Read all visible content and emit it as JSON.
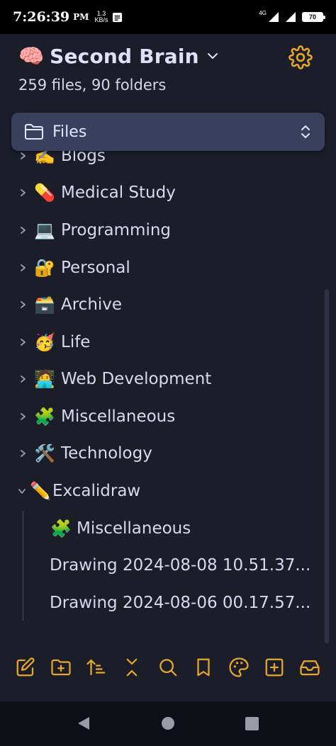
{
  "status_bar": {
    "time": "7:26:39",
    "ampm": "PM",
    "speed_value": "1.3",
    "speed_unit": "KB/s",
    "network": "4G",
    "battery": "70"
  },
  "header": {
    "vault_emoji": "🧠",
    "vault_name": "Second Brain",
    "stats": "259 files, 90 folders"
  },
  "selector": {
    "label": "Files",
    "icon": "folder-icon"
  },
  "tree": {
    "items": [
      {
        "emoji": "✍️",
        "label": "Blogs",
        "state": "collapsed"
      },
      {
        "emoji": "💊",
        "label": "Medical Study",
        "state": "collapsed"
      },
      {
        "emoji": "💻",
        "label": "Programming",
        "state": "collapsed"
      },
      {
        "emoji": "🔐",
        "label": "Personal",
        "state": "collapsed"
      },
      {
        "emoji": "🗃️",
        "label": "Archive",
        "state": "collapsed"
      },
      {
        "emoji": "🥳",
        "label": "Life",
        "state": "collapsed"
      },
      {
        "emoji": "🧑‍💻",
        "label": "Web Development",
        "state": "collapsed"
      },
      {
        "emoji": "🧩",
        "label": "Miscellaneous",
        "state": "collapsed"
      },
      {
        "emoji": "🛠️",
        "label": "Technology",
        "state": "collapsed"
      },
      {
        "emoji": "✏️",
        "label": "Excalidraw",
        "state": "expanded"
      }
    ],
    "children": [
      {
        "emoji": "🧩",
        "label": "Miscellaneous"
      },
      {
        "emoji": "",
        "label": "Drawing 2024-08-08 10.51.37..."
      },
      {
        "emoji": "",
        "label": "Drawing 2024-08-06 00.17.57..."
      }
    ]
  },
  "toolbar": {
    "buttons": [
      "new-note-icon",
      "new-folder-icon",
      "sort-icon",
      "collapse-all-icon",
      "search-icon",
      "bookmark-icon",
      "palette-icon",
      "add-box-icon",
      "inbox-icon"
    ]
  },
  "colors": {
    "background": "#1b1d29",
    "accent": "#e8a92a",
    "selector_bg": "#3a3f5e",
    "text": "#d7d9ee"
  }
}
